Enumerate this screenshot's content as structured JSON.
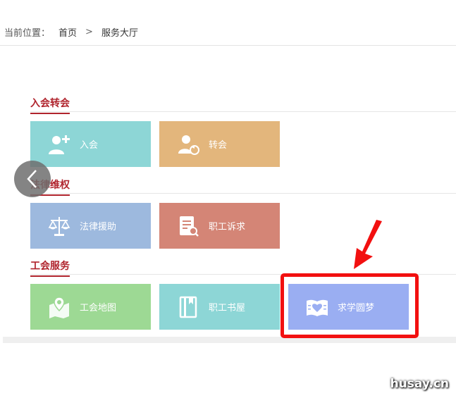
{
  "breadcrumb": {
    "prefix": "当前位置：",
    "items": [
      "首页",
      "服务大厅"
    ],
    "separator": ">"
  },
  "sections": [
    {
      "title": "入会转会",
      "tiles": [
        {
          "label": "入会",
          "color": "#8dd6d6",
          "icon": "add-user-icon"
        },
        {
          "label": "转会",
          "color": "#e3b67c",
          "icon": "transfer-user-icon"
        }
      ]
    },
    {
      "title": "法律维权",
      "tiles": [
        {
          "label": "法律援助",
          "color": "#9db9de",
          "icon": "scales-icon"
        },
        {
          "label": "职工诉求",
          "color": "#d48576",
          "icon": "document-search-icon"
        }
      ]
    },
    {
      "title": "工会服务",
      "tiles": [
        {
          "label": "工会地图",
          "color": "#9dd994",
          "icon": "map-pin-icon"
        },
        {
          "label": "职工书屋",
          "color": "#8dd6d6",
          "icon": "book-icon"
        },
        {
          "label": "求学圆梦",
          "color": "#9aaef2",
          "icon": "heart-book-icon"
        }
      ]
    }
  ],
  "annotation": {
    "color": "#f21010",
    "target": "求学圆梦"
  },
  "watermark": "husay.cn"
}
